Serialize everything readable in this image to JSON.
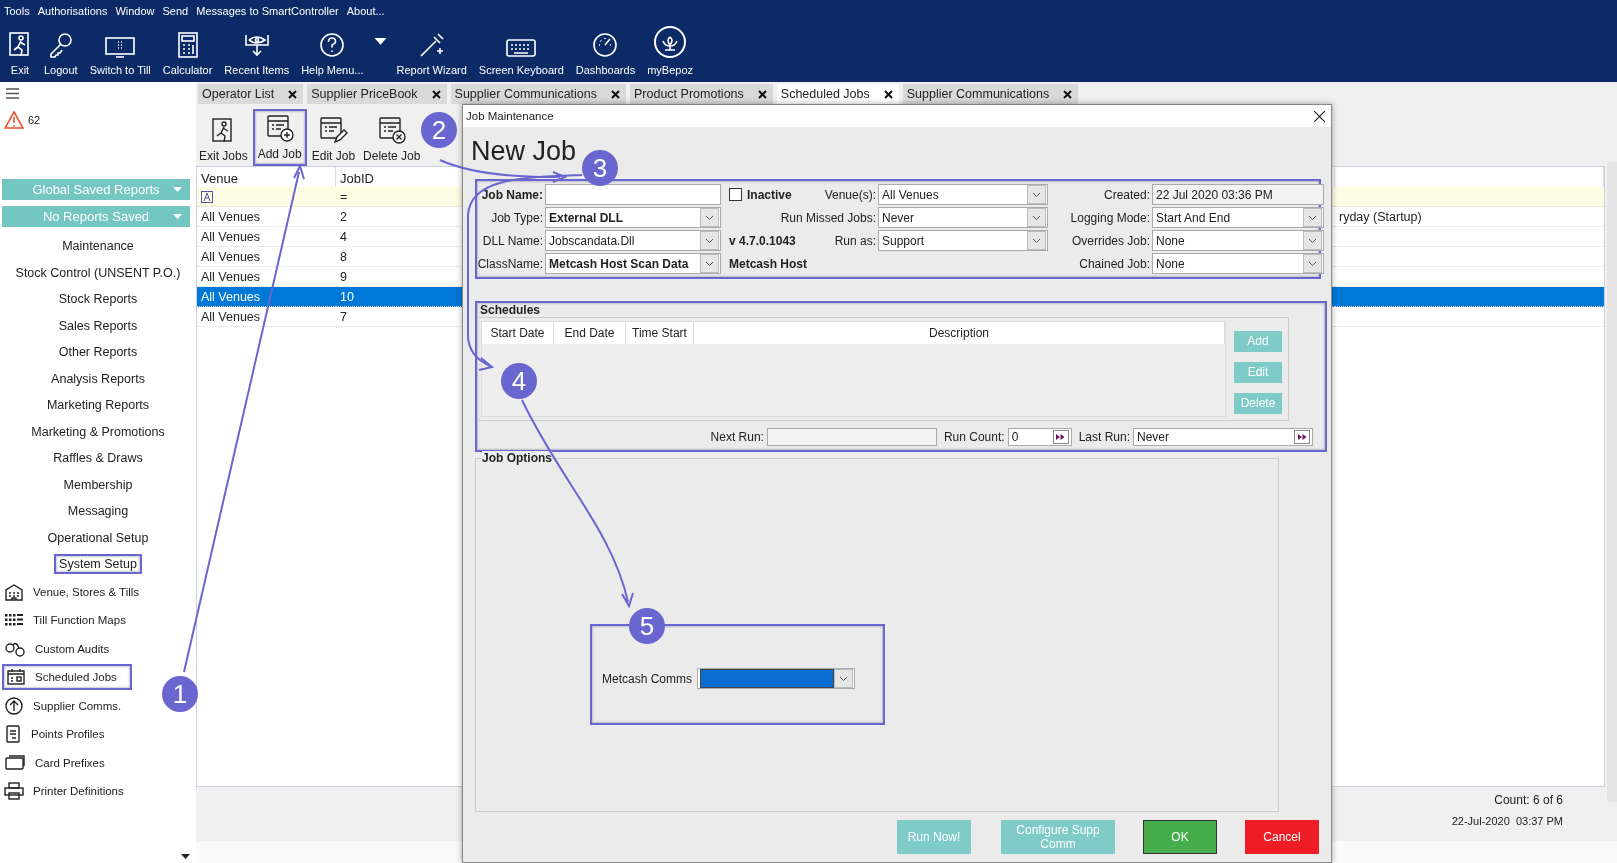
{
  "menu_bar": [
    "Tools",
    "Authorisations",
    "Window",
    "Send",
    "Messages to SmartController",
    "About..."
  ],
  "toolbar": [
    {
      "kind": "exit",
      "label": "Exit"
    },
    {
      "kind": "key",
      "label": "Logout"
    },
    {
      "kind": "till",
      "label": "Switch to Till"
    },
    {
      "kind": "calculator",
      "label": "Calculator"
    },
    {
      "kind": "recent",
      "label": "Recent Items"
    },
    {
      "kind": "help",
      "label": "Help Menu..."
    },
    {
      "kind": "caret"
    },
    {
      "kind": "wizard",
      "label": "Report Wizard"
    },
    {
      "kind": "keyboard",
      "label": "Screen Keyboard"
    },
    {
      "kind": "dashboard",
      "label": "Dashboards"
    },
    {
      "kind": "leaf",
      "label": "myBepoz"
    }
  ],
  "sidebar": {
    "alert_count": "62",
    "dropdowns": [
      "Global Saved Reports",
      "No Reports Saved"
    ],
    "sections": [
      {
        "label": "Maintenance",
        "annotated": false
      },
      {
        "label": "Stock Control (UNSENT P.O.)",
        "annotated": false
      },
      {
        "label": "Stock Reports",
        "annotated": false
      },
      {
        "label": "Sales Reports",
        "annotated": false
      },
      {
        "label": "Other Reports",
        "annotated": false
      },
      {
        "label": "Analysis Reports",
        "annotated": false
      },
      {
        "label": "Marketing Reports",
        "annotated": false
      },
      {
        "label": "Marketing & Promotions",
        "annotated": false
      },
      {
        "label": "Raffles & Draws",
        "annotated": false
      },
      {
        "label": "Membership",
        "annotated": false
      },
      {
        "label": "Messaging",
        "annotated": false
      },
      {
        "label": "Operational Setup",
        "annotated": false
      },
      {
        "label": "System Setup",
        "annotated": true
      }
    ],
    "items": [
      {
        "kind": "building",
        "label": "Venue, Stores & Tills",
        "annotated": false
      },
      {
        "kind": "gridlist",
        "label": "Till Function Maps",
        "annotated": false
      },
      {
        "kind": "cuffs",
        "label": "Custom Audits",
        "annotated": false
      },
      {
        "kind": "calendar",
        "label": "Scheduled Jobs",
        "annotated": true
      },
      {
        "kind": "upload",
        "label": "Supplier Comms.",
        "annotated": false
      },
      {
        "kind": "document",
        "label": "Points Profiles",
        "annotated": false
      },
      {
        "kind": "card",
        "label": "Card Prefixes",
        "annotated": false
      },
      {
        "kind": "printer",
        "label": "Printer Definitions",
        "annotated": false
      }
    ]
  },
  "tabs": [
    {
      "label": "Operator List",
      "selected": false
    },
    {
      "label": "Supplier PriceBook",
      "selected": false
    },
    {
      "label": "Supplier Communications",
      "selected": false
    },
    {
      "label": "Product Promotions",
      "selected": false
    },
    {
      "label": "Scheduled Jobs",
      "selected": true
    },
    {
      "label": "Supplier Communications",
      "selected": false
    }
  ],
  "jobs_toolbar": [
    {
      "kind": "exit",
      "label": "Exit Jobs",
      "annotated": false
    },
    {
      "kind": "add",
      "label": "Add Job",
      "annotated": true
    },
    {
      "kind": "edit",
      "label": "Edit Job",
      "annotated": false
    },
    {
      "kind": "delete",
      "label": "Delete Job",
      "annotated": false
    }
  ],
  "grid": {
    "columns": [
      "Venue",
      "JobID"
    ],
    "filter": {
      "job_id": "="
    },
    "rows": [
      {
        "venue": "All Venues",
        "job_id": "2",
        "column_3": "ryday (Startup)",
        "selected": false
      },
      {
        "venue": "All Venues",
        "job_id": "4",
        "selected": false
      },
      {
        "venue": "All Venues",
        "job_id": "8",
        "selected": false
      },
      {
        "venue": "All Venues",
        "job_id": "9",
        "selected": false
      },
      {
        "venue": "All Venues",
        "job_id": "10",
        "selected": true
      },
      {
        "venue": "All Venues",
        "job_id": "7",
        "selected": false
      }
    ]
  },
  "status_bar": {
    "count": "Count: 6 of 6",
    "datetime": "22-Jul-2020  03:37 PM"
  },
  "dialog": {
    "title": "Job Maintenance",
    "heading": "New Job",
    "details": {
      "annotated": true,
      "rows": [
        {
          "field_1": {
            "label": "Job Name:",
            "kind": "text",
            "strong": true
          },
          "note": {
            "kind": "checkbox",
            "label": "Inactive",
            "checked": false
          },
          "field_2": {
            "label": "Venue(s):",
            "kind": "combo",
            "value": "All Venues"
          },
          "field_3": {
            "label": "Created:",
            "kind": "readonly",
            "value": "22 Jul 2020 03:36 PM"
          }
        },
        {
          "field_1": {
            "label": "Job Type:",
            "kind": "combo",
            "value": "External DLL",
            "strong": true
          },
          "field_2": {
            "label": "Run Missed Jobs:",
            "kind": "combo",
            "value": "Never"
          },
          "field_3": {
            "label": "Logging Mode:",
            "kind": "combo",
            "value": "Start And End"
          }
        },
        {
          "field_1": {
            "label": "DLL Name:",
            "kind": "combo",
            "value": "Jobscandata.Dll"
          },
          "note": {
            "kind": "text",
            "label": "v 4.7.0.1043"
          },
          "field_2": {
            "label": "Run as:",
            "kind": "combo",
            "value": "Support"
          },
          "field_3": {
            "label": "Overrides Job:",
            "kind": "combo",
            "value": "None"
          }
        },
        {
          "field_1": {
            "label": "ClassName:",
            "kind": "combo",
            "value": "Metcash Host Scan Data",
            "strong": true
          },
          "note": {
            "kind": "text",
            "label": "Metcash Host"
          },
          "field_3": {
            "label": "Chained Job:",
            "kind": "combo",
            "value": "None"
          }
        }
      ]
    },
    "schedules": {
      "title": "Schedules",
      "annotated": true,
      "columns": [
        "Start Date",
        "End Date",
        "Time Start",
        "Description"
      ],
      "buttons": [
        "Add",
        "Edit",
        "Delete"
      ],
      "next_run_label": "Next Run:",
      "run_count_label": "Run Count:",
      "run_count": "0",
      "last_run_label": "Last Run:",
      "last_run": "Never"
    },
    "job_options": {
      "title": "Job Options",
      "fields": [
        {
          "label": "Metcash Comms",
          "annotated": true
        }
      ]
    },
    "buttons": [
      {
        "label": "Run Now!",
        "kind": "secondary"
      },
      {
        "label": "Configure Supp Comm",
        "kind": "secondary"
      },
      {
        "label": "OK",
        "kind": "ok"
      },
      {
        "label": "Cancel",
        "kind": "cancel"
      }
    ]
  },
  "callouts": [
    "1",
    "2",
    "3",
    "4",
    "5"
  ]
}
